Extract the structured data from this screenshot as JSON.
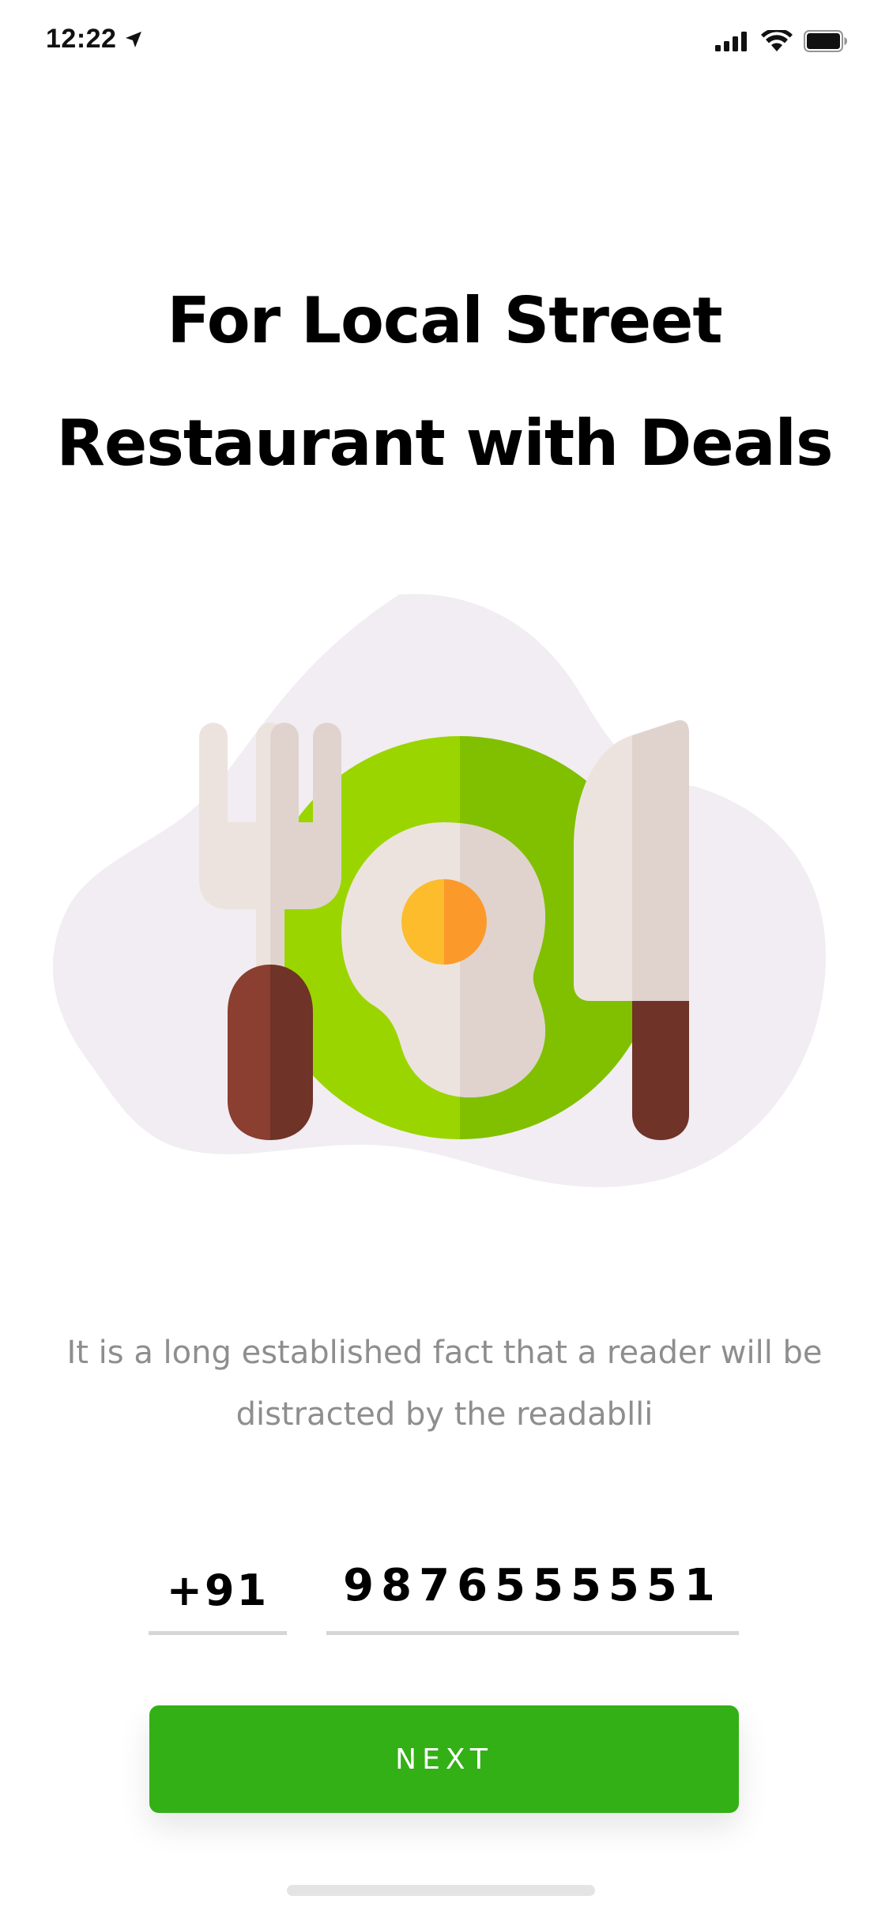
{
  "status_bar": {
    "time": "12:22",
    "icons": [
      "location-arrow-icon",
      "cellular-signal-icon",
      "wifi-icon",
      "battery-icon"
    ]
  },
  "headline": {
    "line1": "For Local Street",
    "line2": "Restaurant with Deals"
  },
  "illustration": {
    "icon": "plate-fork-knife-egg-icon",
    "colors": {
      "blob": "#f1edf2",
      "plate_light": "#9bd500",
      "plate_dark": "#80c000",
      "utensil_light": "#ede3de",
      "utensil_dark": "#e0d3ce",
      "handle_light": "#8a3f31",
      "handle_dark": "#6f3327",
      "yolk_light": "#fcbc2c",
      "yolk_dark": "#fb9a2b"
    }
  },
  "description": "It is a long established fact that a reader will be distracted by the readablli",
  "phone": {
    "country_code": "+91",
    "number": "9876555551"
  },
  "next_button": {
    "label": "NEXT",
    "color": "#33b015"
  }
}
